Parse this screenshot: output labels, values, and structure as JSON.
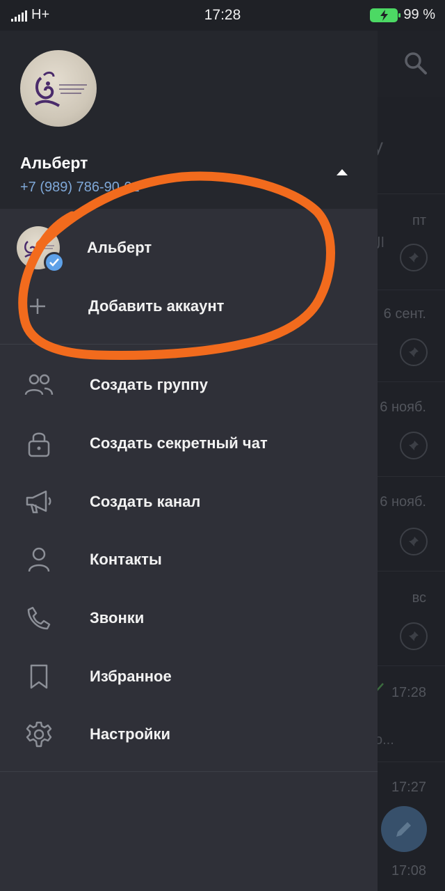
{
  "status_bar": {
    "network": "H+",
    "time": "17:28",
    "battery": "99 %"
  },
  "profile": {
    "name": "Альберт",
    "phone": "+7 (989) 786-90-01"
  },
  "accounts": [
    {
      "name": "Альберт"
    },
    {
      "label": "Добавить аккаунт"
    }
  ],
  "menu": [
    {
      "label": "Создать группу",
      "icon": "group-icon"
    },
    {
      "label": "Создать секретный чат",
      "icon": "lock-icon"
    },
    {
      "label": "Создать канал",
      "icon": "megaphone-icon"
    },
    {
      "label": "Контакты",
      "icon": "person-icon"
    },
    {
      "label": "Звонки",
      "icon": "phone-icon"
    },
    {
      "label": "Избранное",
      "icon": "bookmark-icon"
    },
    {
      "label": "Настройки",
      "icon": "gear-icon"
    }
  ],
  "background_chats": {
    "header_fragment": "у",
    "items": [
      {
        "time": "пт",
        "snippet": "ال"
      },
      {
        "time": "6 сент."
      },
      {
        "time": "6 нояб."
      },
      {
        "time": "6 нояб."
      },
      {
        "time": "вс"
      },
      {
        "time": "17:28",
        "snippet": "о..."
      },
      {
        "time": "17:27"
      },
      {
        "time": "17:08"
      }
    ]
  },
  "colors": {
    "drawer_bg": "#2f3038",
    "header_bg": "#25272d",
    "phone_link": "#7fa8d8",
    "annotation": "#f26b1d",
    "check_badge": "#5ea1e8"
  }
}
